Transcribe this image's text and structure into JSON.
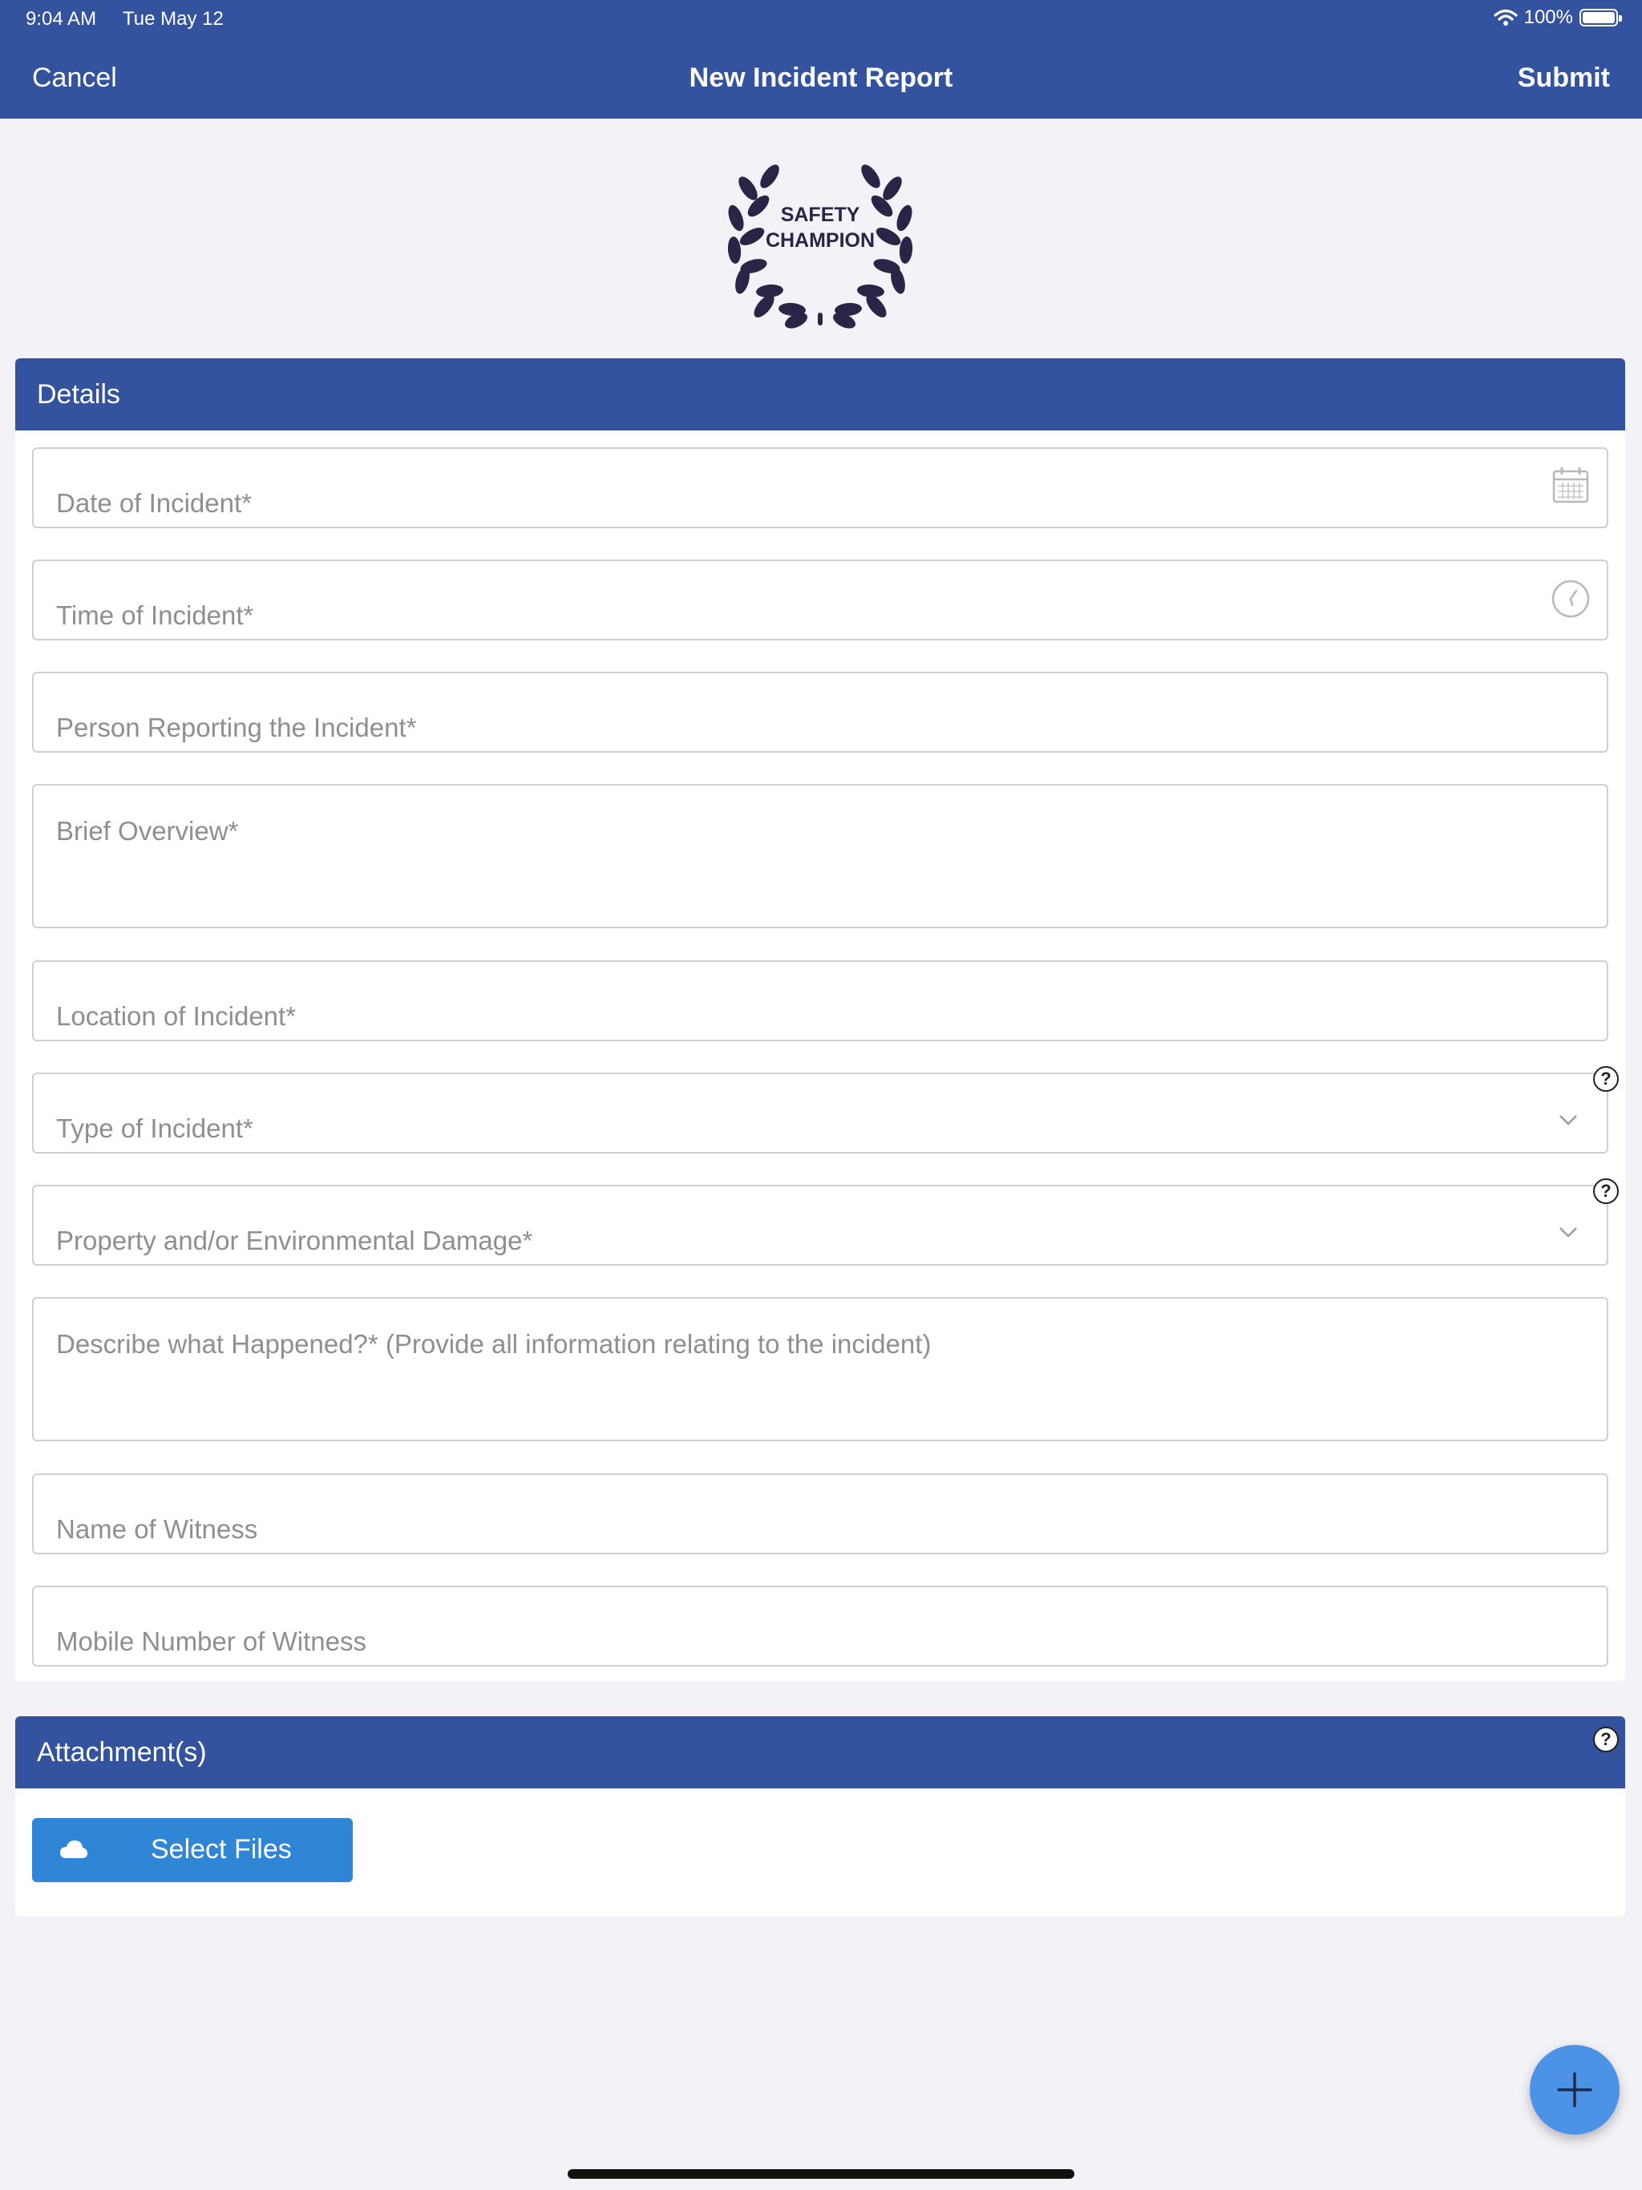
{
  "status_bar": {
    "time": "9:04 AM",
    "date": "Tue May 12",
    "battery": "100%"
  },
  "nav": {
    "cancel": "Cancel",
    "title": "New Incident Report",
    "submit": "Submit"
  },
  "logo": {
    "line1": "SAFETY",
    "line2": "CHAMPION"
  },
  "details": {
    "header": "Details",
    "fields": {
      "date": "Date of Incident*",
      "time": "Time of Incident*",
      "person": "Person Reporting the Incident*",
      "overview": "Brief Overview*",
      "location": "Location of Incident*",
      "type": "Type of Incident*",
      "damage": "Property and/or Environmental Damage*",
      "describe": "Describe what Happened?* (Provide all information relating to the incident)",
      "witness_name": "Name of Witness",
      "witness_mobile": "Mobile Number of Witness"
    }
  },
  "attachments": {
    "header": "Attachment(s)",
    "select_files": "Select Files"
  },
  "help_glyph": "?",
  "colors": {
    "header_blue": "#34539e",
    "button_blue": "#2f86d6",
    "fab_blue": "#4c93e8",
    "logo_navy": "#2a2447",
    "placeholder_gray": "#8e8e93"
  },
  "icons": [
    "wifi-icon",
    "battery-icon",
    "laurel-wreath-icon",
    "calendar-icon",
    "clock-icon",
    "chevron-down-icon",
    "help-icon",
    "cloud-upload-icon",
    "plus-icon"
  ]
}
